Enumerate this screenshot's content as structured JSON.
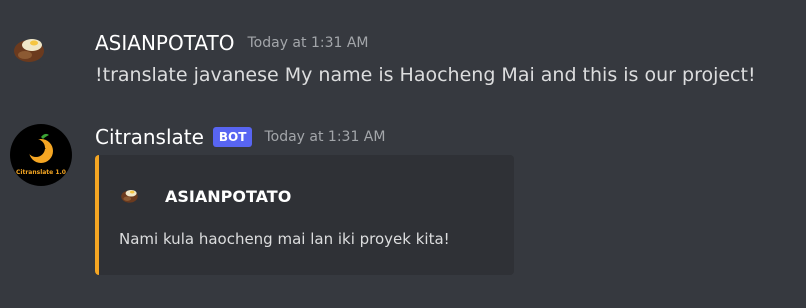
{
  "messages": [
    {
      "author": "ASIANPOTATO",
      "timestamp": "Today at 1:31 AM",
      "avatar_icon": "potato-avatar-icon",
      "content": "!translate javanese My name is Haocheng Mai and this is our project!"
    },
    {
      "author": "Citranslate",
      "bot_tag": "BOT",
      "timestamp": "Today at 1:31 AM",
      "avatar_icon": "orange-moon-logo-icon",
      "avatar_text": "Citranslate 1.0",
      "embed": {
        "accent_color": "#f5a623",
        "author_icon": "potato-avatar-icon",
        "author_name": "ASIANPOTATO",
        "description": "Nami kula haocheng mai lan iki proyek kita!"
      }
    }
  ],
  "colors": {
    "background": "#36393f",
    "embed_background": "#2f3136",
    "bot_tag": "#5865f2",
    "embed_accent": "#f5a623"
  }
}
